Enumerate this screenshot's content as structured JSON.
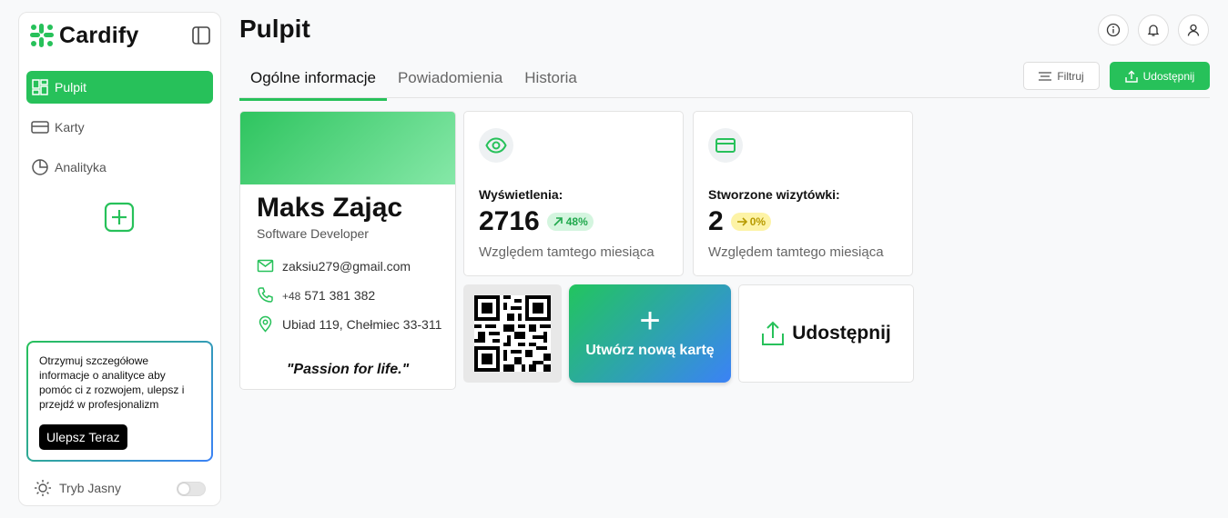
{
  "app": {
    "name": "Cardify"
  },
  "sidebar": {
    "items": [
      {
        "label": "Pulpit",
        "icon": "dashboard-icon",
        "active": true
      },
      {
        "label": "Karty",
        "icon": "card-icon",
        "active": false
      },
      {
        "label": "Analityka",
        "icon": "pie-chart-icon",
        "active": false
      }
    ],
    "promo": {
      "text": "Otrzymuj szczegółowe informacje o analityce aby pomóc ci z rozwojem, ulepsz i przejdź w profesjonalizm",
      "button": "Ulepsz Teraz"
    },
    "theme_label": "Tryb Jasny"
  },
  "header": {
    "title": "Pulpit",
    "tabs": [
      {
        "label": "Ogólne informacje",
        "active": true
      },
      {
        "label": "Powiadomienia",
        "active": false
      },
      {
        "label": "Historia",
        "active": false
      }
    ],
    "filter_label": "Filtruj",
    "share_label": "Udostępnij"
  },
  "card": {
    "name": "Maks Zając",
    "role": "Software Developer",
    "email": "zaksiu279@gmail.com",
    "phone_prefix": "+48",
    "phone": "571 381 382",
    "address": "Ubiad 119, Chełmiec 33-311",
    "motto": "\"Passion for life.\""
  },
  "stats": [
    {
      "label": "Wyświetlenia:",
      "value": "2716",
      "badge": "48%",
      "trend": "up",
      "sub": "Względem tamtego miesiąca"
    },
    {
      "label": "Stworzone wizytówki:",
      "value": "2",
      "badge": "0%",
      "trend": "flat",
      "sub": "Względem tamtego miesiąca"
    }
  ],
  "actions": {
    "create_label": "Utwórz nową kartę",
    "create_symbol": "+",
    "share_label": "Udostępnij"
  },
  "colors": {
    "accent": "#27c15a",
    "accent_blue": "#3b82f6"
  }
}
